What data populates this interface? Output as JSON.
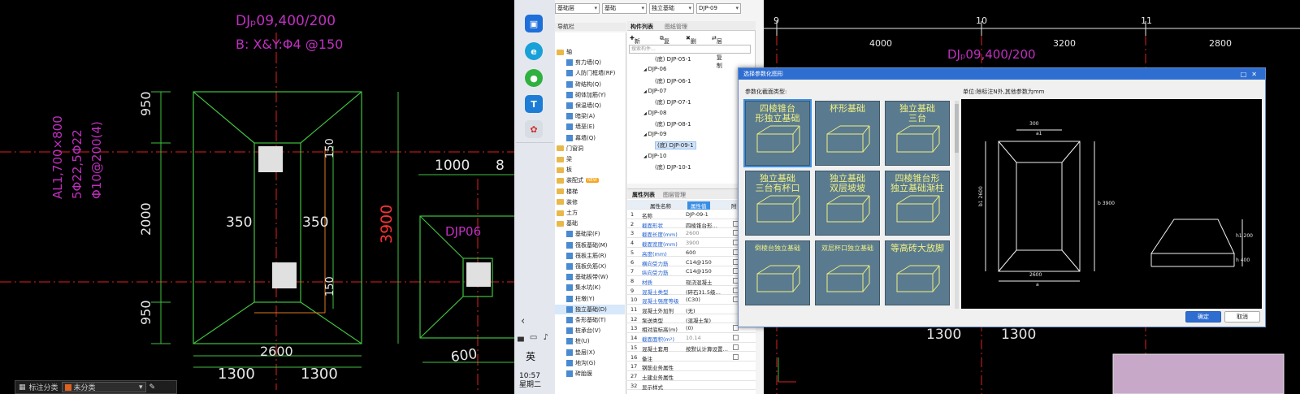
{
  "left_cad": {
    "label_title": "DJₚ09,400/200",
    "label_rebar": "B: X&Y:Φ4 @150",
    "dim_950_top": "950",
    "dim_2000": "2000",
    "dim_950_bot": "950",
    "dim_350_left": "350",
    "dim_350_right": "350",
    "dim_150_top": "150",
    "dim_150_bot": "150",
    "dim_3900": "3900",
    "dim_2600": "2600",
    "dim_1300_a": "1300",
    "dim_1300_b": "1300",
    "dim_1000": "1000",
    "dim_8": "8",
    "dim_600": "600",
    "col_label": "AL1,700×800",
    "col_rebar1": "5Φ22,5Φ22",
    "col_rebar2": "Φ10@200(4)",
    "djp06": "DJP06",
    "statusbar_label": "标注分类",
    "statusbar_value": "未分类"
  },
  "taskbar": {
    "ime": "英",
    "time": "10:57",
    "weekday": "星期二",
    "tray": "▄ ▭ ♪"
  },
  "app": {
    "top_dropdowns": [
      "基础层",
      "基础",
      "独立基础",
      "DJP-09"
    ],
    "nav_title": "导航栏",
    "nav_items": [
      {
        "label": "轴",
        "type": "folder"
      },
      {
        "label": "剪力墙(Q)",
        "type": "item"
      },
      {
        "label": "人防门框墙(RF)",
        "type": "item"
      },
      {
        "label": "砖结构(Q)",
        "type": "item"
      },
      {
        "label": "砌体加筋(Y)",
        "type": "item"
      },
      {
        "label": "保温墙(Q)",
        "type": "item"
      },
      {
        "label": "暗梁(A)",
        "type": "item"
      },
      {
        "label": "墙垩(E)",
        "type": "item"
      },
      {
        "label": "幕墙(Q)",
        "type": "item"
      },
      {
        "label": "门窗洞",
        "type": "folder"
      },
      {
        "label": "梁",
        "type": "folder"
      },
      {
        "label": "板",
        "type": "folder"
      },
      {
        "label": "装配式",
        "type": "folder",
        "badge": "NEW"
      },
      {
        "label": "楼梯",
        "type": "folder"
      },
      {
        "label": "装修",
        "type": "folder"
      },
      {
        "label": "土方",
        "type": "folder"
      },
      {
        "label": "基础",
        "type": "folder"
      },
      {
        "label": "基础梁(F)",
        "type": "item"
      },
      {
        "label": "筏板基础(M)",
        "type": "item"
      },
      {
        "label": "筏板主筋(R)",
        "type": "item"
      },
      {
        "label": "筏板负筋(X)",
        "type": "item"
      },
      {
        "label": "基础板带(W)",
        "type": "item"
      },
      {
        "label": "集水坑(K)",
        "type": "item"
      },
      {
        "label": "柱墩(Y)",
        "type": "item"
      },
      {
        "label": "独立基础(D)",
        "type": "item",
        "active": true
      },
      {
        "label": "条形基础(T)",
        "type": "item"
      },
      {
        "label": "桩承台(V)",
        "type": "item"
      },
      {
        "label": "桩(U)",
        "type": "item"
      },
      {
        "label": "垫层(X)",
        "type": "item"
      },
      {
        "label": "地沟(G)",
        "type": "item"
      },
      {
        "label": "砖胎膜",
        "type": "item"
      }
    ],
    "comp_tab1": "构件列表",
    "comp_tab2": "图纸管理",
    "tool_new": "新建",
    "tool_copy": "复制",
    "tool_delete": "删除",
    "tool_floor": "层间复制",
    "search_placeholder": "搜索构件...",
    "comp_items": [
      {
        "label": "(底) DJP-05-1",
        "level": 2
      },
      {
        "label": "DJP-06",
        "level": 1
      },
      {
        "label": "(底) DJP-06-1",
        "level": 2
      },
      {
        "label": "DJP-07",
        "level": 1
      },
      {
        "label": "(底) DJP-07-1",
        "level": 2
      },
      {
        "label": "DJP-08",
        "level": 1
      },
      {
        "label": "(底) DJP-08-1",
        "level": 2
      },
      {
        "label": "DJP-09",
        "level": 1
      },
      {
        "label": "(底) DJP-09-1",
        "level": 2,
        "selected": true
      },
      {
        "label": "DJP-10",
        "level": 1
      },
      {
        "label": "(底) DJP-10-1",
        "level": 2
      }
    ],
    "prop_tab1": "属性列表",
    "prop_tab2": "图层管理",
    "prop_header": [
      "属性名称",
      "属性值",
      "附"
    ],
    "props": [
      {
        "n": "1",
        "name": "名称",
        "value": "DJP-09-1",
        "style": ""
      },
      {
        "n": "2",
        "name": "截面形状",
        "value": "四棱锥台形…",
        "style": "blue",
        "chk": true
      },
      {
        "n": "3",
        "name": "截面长度(mm)",
        "value": "2600",
        "style": "gray",
        "chk": true
      },
      {
        "n": "4",
        "name": "截面宽度(mm)",
        "value": "3900",
        "style": "gray",
        "chk": true
      },
      {
        "n": "5",
        "name": "高度(mm)",
        "value": "600",
        "style": "",
        "chk": true
      },
      {
        "n": "6",
        "name": "横向受力筋",
        "value": "C14@150",
        "style": "",
        "chk": true
      },
      {
        "n": "7",
        "name": "纵向受力筋",
        "value": "C14@150",
        "style": "",
        "chk": true
      },
      {
        "n": "8",
        "name": "材质",
        "value": "现浇混凝土",
        "style": "",
        "chk": true
      },
      {
        "n": "9",
        "name": "混凝土类型",
        "value": "(碎石31.5级…",
        "style": "",
        "chk": true
      },
      {
        "n": "10",
        "name": "混凝土强度等级",
        "value": "(C30)",
        "style": "",
        "chk": true
      },
      {
        "n": "11",
        "name": "混凝土外加剂",
        "value": "(无)",
        "style": "",
        "chk": false
      },
      {
        "n": "12",
        "name": "泵送类型",
        "value": "(混凝土泵)",
        "style": "",
        "chk": false
      },
      {
        "n": "13",
        "name": "相对底标高(m)",
        "value": "(0)",
        "style": "",
        "chk": true
      },
      {
        "n": "14",
        "name": "截面面积(m²)",
        "value": "10.14",
        "style": "gray",
        "chk": true
      },
      {
        "n": "15",
        "name": "混凝土套用",
        "value": "按默认计算设置…",
        "style": "",
        "chk": true
      },
      {
        "n": "16",
        "name": "备注",
        "value": "",
        "style": "",
        "chk": true
      },
      {
        "n": "17",
        "name": "钢筋业务属性",
        "value": "",
        "style": "",
        "chk": false
      },
      {
        "n": "27",
        "name": "土建业务属性",
        "value": "",
        "style": "",
        "chk": false
      },
      {
        "n": "32",
        "name": "显示样式",
        "value": "",
        "style": "",
        "chk": false
      }
    ]
  },
  "dialog": {
    "title": "选择参数化图形",
    "section_label": "参数化截面类型:",
    "unit_label": "单位:除标注N外,其他参数为mm",
    "thumbs": [
      "四棱锥台\n形独立基础",
      "杯形基础",
      "独立基础\n三台",
      "独立基础\n三台有杯口",
      "独立基础\n双层坡坡",
      "四棱锥台形\n独立基础渐柱",
      "倒棱台独立基础",
      "双层杯口独立基础",
      "等高砖大放脚"
    ],
    "preview_dims": {
      "top_w": "300",
      "top_a1": "a1",
      "side_b": "b 3900",
      "side_b1": "b1 2600",
      "bot_w": "2600",
      "bot_a": "a",
      "h1": "h1 200",
      "h": "h 400"
    },
    "ok": "确定",
    "cancel": "取消"
  },
  "right_cad": {
    "axis_9": "9",
    "axis_10": "10",
    "axis_11": "11",
    "dim_4000": "4000",
    "dim_3200": "3200",
    "dim_2800": "2800",
    "label_title": "DJₚ09,400/200",
    "dim_1300_a": "1300",
    "dim_1300_b": "1300"
  }
}
